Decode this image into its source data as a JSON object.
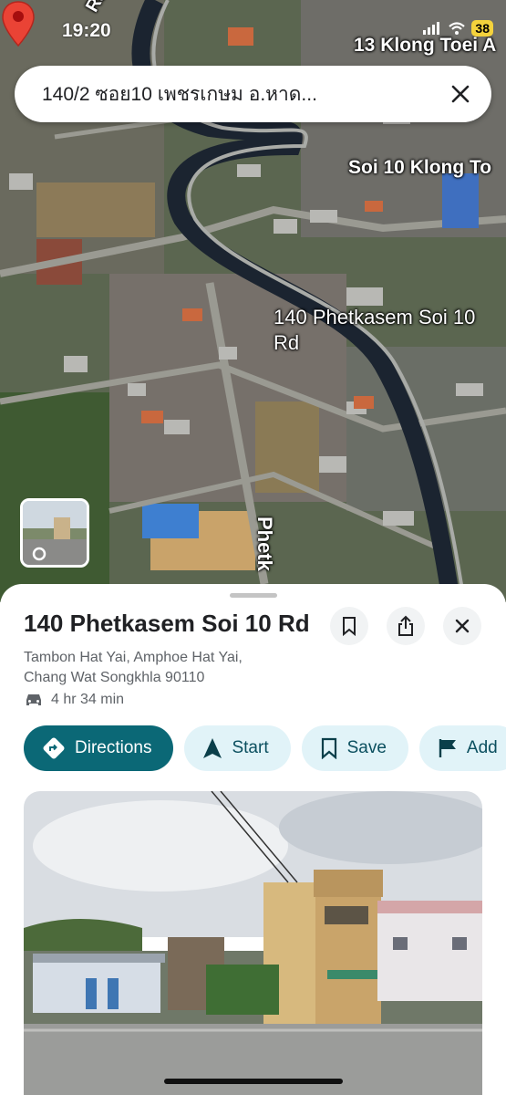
{
  "status_bar": {
    "time": "19:20",
    "battery": "38"
  },
  "search": {
    "query": "140/2 ซอย10 เพชรเกษม อ.หาด..."
  },
  "map_labels": {
    "klong_toei_a": "13 Klong Toei A",
    "soi_10_klong": "Soi 10 Klong To",
    "pin_label": "140 Phetkasem Soi 10 Rd",
    "phetk": "Phetk",
    "rab_klong": "Rab-Klong"
  },
  "place": {
    "title": "140 Phetkasem Soi 10 Rd",
    "address_line1": "Tambon Hat Yai, Amphoe Hat Yai,",
    "address_line2": "Chang Wat Songkhla 90110",
    "drive_time": "4 hr 34 min"
  },
  "actions": {
    "directions": "Directions",
    "start": "Start",
    "save": "Save",
    "add": "Add"
  },
  "icons": [
    "close-icon",
    "bookmark-icon",
    "share-icon",
    "car-icon",
    "directions-icon",
    "navigation-arrow-icon",
    "flag-icon",
    "street-view-icon",
    "map-pin-icon"
  ],
  "colors": {
    "primary": "#0b6876",
    "chip": "#e1f3f8",
    "pin": "#ea4335",
    "canal": "#1b2430"
  }
}
